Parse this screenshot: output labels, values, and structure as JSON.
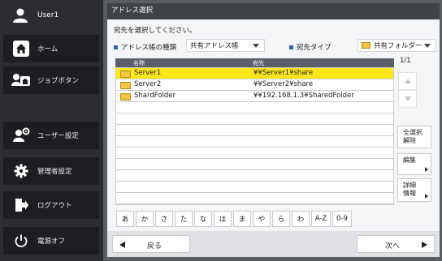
{
  "sidebar": {
    "user_name": "User1",
    "items": [
      {
        "label": "ホーム",
        "icon": "home-icon"
      },
      {
        "label": "ジョブボタン",
        "icon": "job-button-icon"
      },
      {
        "label": "ユーザー設定",
        "icon": "user-settings-icon"
      },
      {
        "label": "管理者設定",
        "icon": "gear-icon"
      },
      {
        "label": "ログアウト",
        "icon": "logout-icon"
      },
      {
        "label": "電源オフ",
        "icon": "power-icon"
      }
    ]
  },
  "header": {
    "title": "アドレス選択"
  },
  "instruction": "宛先を選択してください。",
  "filters": {
    "book_type_label": "アドレス帳の種類",
    "book_type_value": "共有アドレス帳",
    "dest_type_label": "宛先タイプ",
    "dest_type_value": "共有フォルダー"
  },
  "table": {
    "headers": {
      "name": "名称",
      "address": "宛先"
    },
    "rows": [
      {
        "name": "Server1",
        "address": "¥¥Server1¥share",
        "selected": true
      },
      {
        "name": "Server2",
        "address": "¥¥Server2¥share",
        "selected": false
      },
      {
        "name": "ShardFolder",
        "address": "¥¥192.168.1.3¥SharedFolder",
        "selected": false
      }
    ]
  },
  "page_indicator": "1/1",
  "right_buttons": {
    "select_all": "全選択\n解除",
    "edit": "編集",
    "details": "詳細\n情報"
  },
  "kana_keys": [
    "あ",
    "か",
    "さ",
    "た",
    "な",
    "は",
    "ま",
    "や",
    "ら",
    "わ",
    "A-Z",
    "0-9"
  ],
  "nav": {
    "back": "戻る",
    "next": "次へ"
  },
  "colors": {
    "selected_row": "#ffe71a",
    "header_bar": "#3f4247",
    "sidebar": "#2b2d31",
    "accent_blue": "#2e5fbf"
  }
}
